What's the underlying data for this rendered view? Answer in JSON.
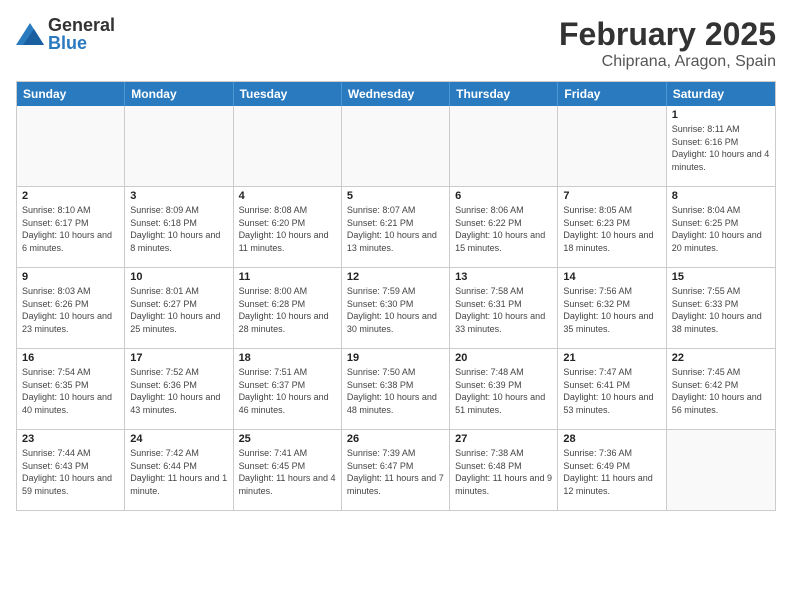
{
  "header": {
    "logo_general": "General",
    "logo_blue": "Blue",
    "title": "February 2025",
    "location": "Chiprana, Aragon, Spain"
  },
  "days_of_week": [
    "Sunday",
    "Monday",
    "Tuesday",
    "Wednesday",
    "Thursday",
    "Friday",
    "Saturday"
  ],
  "weeks": [
    [
      {
        "day": "",
        "info": ""
      },
      {
        "day": "",
        "info": ""
      },
      {
        "day": "",
        "info": ""
      },
      {
        "day": "",
        "info": ""
      },
      {
        "day": "",
        "info": ""
      },
      {
        "day": "",
        "info": ""
      },
      {
        "day": "1",
        "info": "Sunrise: 8:11 AM\nSunset: 6:16 PM\nDaylight: 10 hours and 4 minutes."
      }
    ],
    [
      {
        "day": "2",
        "info": "Sunrise: 8:10 AM\nSunset: 6:17 PM\nDaylight: 10 hours and 6 minutes."
      },
      {
        "day": "3",
        "info": "Sunrise: 8:09 AM\nSunset: 6:18 PM\nDaylight: 10 hours and 8 minutes."
      },
      {
        "day": "4",
        "info": "Sunrise: 8:08 AM\nSunset: 6:20 PM\nDaylight: 10 hours and 11 minutes."
      },
      {
        "day": "5",
        "info": "Sunrise: 8:07 AM\nSunset: 6:21 PM\nDaylight: 10 hours and 13 minutes."
      },
      {
        "day": "6",
        "info": "Sunrise: 8:06 AM\nSunset: 6:22 PM\nDaylight: 10 hours and 15 minutes."
      },
      {
        "day": "7",
        "info": "Sunrise: 8:05 AM\nSunset: 6:23 PM\nDaylight: 10 hours and 18 minutes."
      },
      {
        "day": "8",
        "info": "Sunrise: 8:04 AM\nSunset: 6:25 PM\nDaylight: 10 hours and 20 minutes."
      }
    ],
    [
      {
        "day": "9",
        "info": "Sunrise: 8:03 AM\nSunset: 6:26 PM\nDaylight: 10 hours and 23 minutes."
      },
      {
        "day": "10",
        "info": "Sunrise: 8:01 AM\nSunset: 6:27 PM\nDaylight: 10 hours and 25 minutes."
      },
      {
        "day": "11",
        "info": "Sunrise: 8:00 AM\nSunset: 6:28 PM\nDaylight: 10 hours and 28 minutes."
      },
      {
        "day": "12",
        "info": "Sunrise: 7:59 AM\nSunset: 6:30 PM\nDaylight: 10 hours and 30 minutes."
      },
      {
        "day": "13",
        "info": "Sunrise: 7:58 AM\nSunset: 6:31 PM\nDaylight: 10 hours and 33 minutes."
      },
      {
        "day": "14",
        "info": "Sunrise: 7:56 AM\nSunset: 6:32 PM\nDaylight: 10 hours and 35 minutes."
      },
      {
        "day": "15",
        "info": "Sunrise: 7:55 AM\nSunset: 6:33 PM\nDaylight: 10 hours and 38 minutes."
      }
    ],
    [
      {
        "day": "16",
        "info": "Sunrise: 7:54 AM\nSunset: 6:35 PM\nDaylight: 10 hours and 40 minutes."
      },
      {
        "day": "17",
        "info": "Sunrise: 7:52 AM\nSunset: 6:36 PM\nDaylight: 10 hours and 43 minutes."
      },
      {
        "day": "18",
        "info": "Sunrise: 7:51 AM\nSunset: 6:37 PM\nDaylight: 10 hours and 46 minutes."
      },
      {
        "day": "19",
        "info": "Sunrise: 7:50 AM\nSunset: 6:38 PM\nDaylight: 10 hours and 48 minutes."
      },
      {
        "day": "20",
        "info": "Sunrise: 7:48 AM\nSunset: 6:39 PM\nDaylight: 10 hours and 51 minutes."
      },
      {
        "day": "21",
        "info": "Sunrise: 7:47 AM\nSunset: 6:41 PM\nDaylight: 10 hours and 53 minutes."
      },
      {
        "day": "22",
        "info": "Sunrise: 7:45 AM\nSunset: 6:42 PM\nDaylight: 10 hours and 56 minutes."
      }
    ],
    [
      {
        "day": "23",
        "info": "Sunrise: 7:44 AM\nSunset: 6:43 PM\nDaylight: 10 hours and 59 minutes."
      },
      {
        "day": "24",
        "info": "Sunrise: 7:42 AM\nSunset: 6:44 PM\nDaylight: 11 hours and 1 minute."
      },
      {
        "day": "25",
        "info": "Sunrise: 7:41 AM\nSunset: 6:45 PM\nDaylight: 11 hours and 4 minutes."
      },
      {
        "day": "26",
        "info": "Sunrise: 7:39 AM\nSunset: 6:47 PM\nDaylight: 11 hours and 7 minutes."
      },
      {
        "day": "27",
        "info": "Sunrise: 7:38 AM\nSunset: 6:48 PM\nDaylight: 11 hours and 9 minutes."
      },
      {
        "day": "28",
        "info": "Sunrise: 7:36 AM\nSunset: 6:49 PM\nDaylight: 11 hours and 12 minutes."
      },
      {
        "day": "",
        "info": ""
      }
    ]
  ]
}
